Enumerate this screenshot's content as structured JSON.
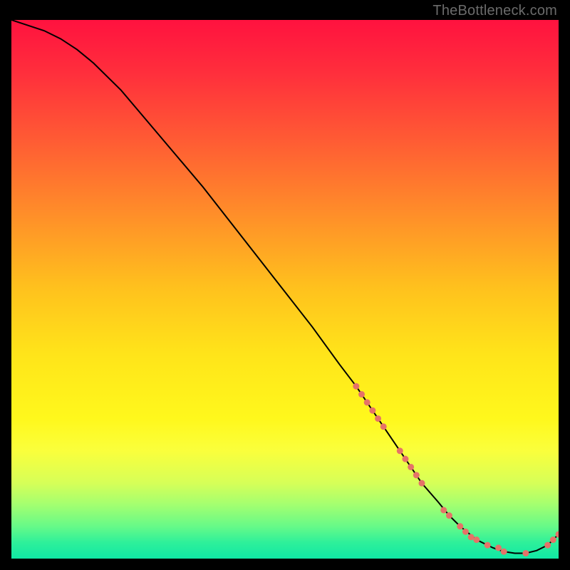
{
  "watermark": "TheBottleneck.com",
  "colors": {
    "curve": "#000000",
    "marker": "#e57368",
    "gradient_stops": [
      {
        "offset": 0.0,
        "color": "#ff123f"
      },
      {
        "offset": 0.1,
        "color": "#ff2f3c"
      },
      {
        "offset": 0.22,
        "color": "#ff5a34"
      },
      {
        "offset": 0.35,
        "color": "#ff8a2a"
      },
      {
        "offset": 0.5,
        "color": "#ffc21d"
      },
      {
        "offset": 0.62,
        "color": "#ffe41a"
      },
      {
        "offset": 0.74,
        "color": "#fff81c"
      },
      {
        "offset": 0.8,
        "color": "#faff3c"
      },
      {
        "offset": 0.86,
        "color": "#d6ff58"
      },
      {
        "offset": 0.9,
        "color": "#a3ff70"
      },
      {
        "offset": 0.94,
        "color": "#67fa88"
      },
      {
        "offset": 0.97,
        "color": "#2ef09a"
      },
      {
        "offset": 1.0,
        "color": "#10e8a5"
      }
    ]
  },
  "chart_data": {
    "type": "line",
    "title": "",
    "xlabel": "",
    "ylabel": "",
    "xlim": [
      0,
      100
    ],
    "ylim": [
      0,
      100
    ],
    "series": [
      {
        "name": "curve",
        "x": [
          0,
          3,
          6,
          9,
          12,
          15,
          20,
          25,
          30,
          35,
          40,
          45,
          50,
          55,
          60,
          63,
          65,
          68,
          70,
          73,
          75,
          78,
          80,
          82,
          85,
          88,
          90,
          92,
          94,
          96,
          98,
          100
        ],
        "y": [
          100,
          99,
          98,
          96.5,
          94.5,
          92,
          87,
          81,
          75,
          69,
          62.5,
          56,
          49.5,
          43,
          36,
          32,
          29,
          24.5,
          21.5,
          17,
          14,
          10.5,
          8,
          6,
          3.5,
          2,
          1.3,
          1,
          1,
          1.5,
          2.5,
          4.5
        ]
      }
    ],
    "markers": {
      "name": "points",
      "x": [
        63,
        64,
        65,
        66,
        67,
        68,
        71,
        72,
        73,
        74,
        75,
        79,
        80,
        82,
        83,
        84,
        85,
        87,
        89,
        90,
        94,
        98,
        99,
        100
      ],
      "y": [
        32,
        30.5,
        29,
        27.5,
        26,
        24.5,
        20,
        18.5,
        17,
        15.5,
        14,
        9,
        8,
        6,
        5,
        4,
        3.5,
        2.5,
        2,
        1.3,
        1,
        2.5,
        3.5,
        4.5
      ],
      "r": 4.5
    }
  }
}
